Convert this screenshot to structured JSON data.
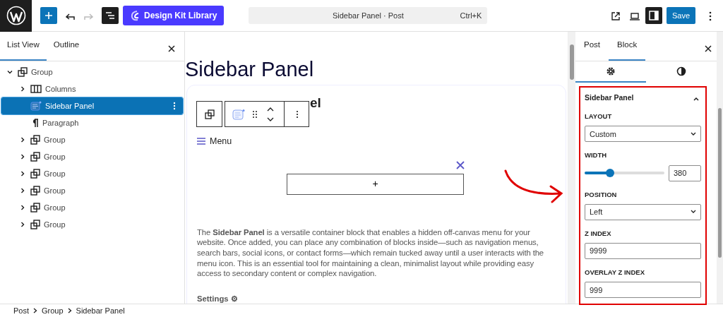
{
  "topbar": {
    "undo_disabled": false,
    "redo_disabled": true,
    "library_button": "Design Kit Library",
    "command_bar": {
      "title": "Sidebar Panel · Post",
      "shortcut": "Ctrl+K"
    },
    "settings_toggle_on": true,
    "save_button": "Save"
  },
  "list_view": {
    "tabs": [
      {
        "label": "List View",
        "selected": true
      },
      {
        "label": "Outline",
        "selected": false
      }
    ],
    "tree": [
      {
        "label": "Group",
        "kind": "group",
        "expanded": true,
        "selected": false,
        "children": [
          {
            "label": "Columns",
            "kind": "columns",
            "expanded": false,
            "selected": false
          },
          {
            "label": "Sidebar Panel",
            "kind": "sidebar",
            "selected": true
          },
          {
            "label": "Paragraph",
            "kind": "paragraph",
            "selected": false
          },
          {
            "label": "Group",
            "kind": "group",
            "expanded": false,
            "selected": false
          },
          {
            "label": "Group",
            "kind": "group",
            "expanded": false,
            "selected": false
          },
          {
            "label": "Group",
            "kind": "group",
            "expanded": false,
            "selected": false
          },
          {
            "label": "Group",
            "kind": "group",
            "expanded": false,
            "selected": false
          },
          {
            "label": "Group",
            "kind": "group",
            "expanded": false,
            "selected": false
          },
          {
            "label": "Group",
            "kind": "group",
            "expanded": false,
            "selected": false
          }
        ]
      }
    ]
  },
  "canvas": {
    "title": "Sidebar Panel",
    "heading_fragment": "el",
    "menu_label": "Menu",
    "append_button": "+",
    "description": "The **Sidebar Panel** is a versatile container block that enables a hidden off-canvas menu for your website. Once added, you can place any combination of blocks inside—such as navigation menus, search bars, social icons, or contact forms—which remain tucked away until a user interacts with the menu icon. This is an essential tool for maintaining a clean, minimalist layout while providing easy access to secondary content or complex navigation.",
    "settings_label": "Settings ⚙"
  },
  "inspector": {
    "tabs": [
      {
        "label": "Post",
        "selected": false
      },
      {
        "label": "Block",
        "selected": true
      }
    ],
    "icon_tabs": [
      {
        "kind": "settings",
        "selected": true
      },
      {
        "kind": "styles",
        "selected": false
      }
    ],
    "panel": {
      "title": "Sidebar Panel",
      "expanded": true,
      "fields": [
        {
          "kind": "select",
          "label": "LAYOUT",
          "value": "Custom"
        },
        {
          "kind": "range",
          "label": "WIDTH",
          "level": 0.32,
          "value": "380"
        },
        {
          "kind": "select",
          "label": "POSITION",
          "value": "Left"
        },
        {
          "kind": "text",
          "label": "Z INDEX",
          "value": "9999"
        },
        {
          "kind": "text",
          "label": "OVERLAY Z INDEX",
          "value": "999"
        }
      ]
    }
  },
  "breadcrumb": [
    "Post",
    "Group",
    "Sidebar Panel"
  ]
}
